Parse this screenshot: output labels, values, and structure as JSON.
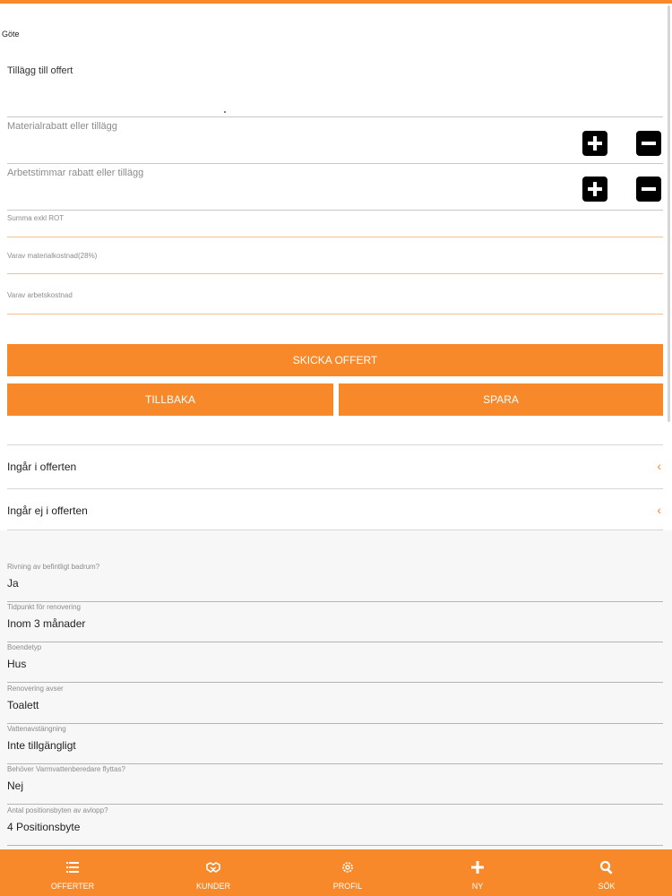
{
  "customer": {
    "name": "Göte"
  },
  "offer": {
    "title": "Tillägg till offert",
    "material_adjust_placeholder": "Materialrabatt eller tillägg",
    "labor_adjust_placeholder": "Arbetstimmar rabatt eller tillägg",
    "sum_label": "Summa exkl ROT",
    "material_cost_label": "Varav materialkostnad(28%)",
    "labor_cost_label": "Varav arbetskostnad"
  },
  "actions": {
    "send": "SKICKA OFFERT",
    "back": "TILLBAKA",
    "save": "SPARA"
  },
  "sections": [
    {
      "label": "Ingår i offerten"
    },
    {
      "label": "Ingår ej i offerten"
    }
  ],
  "details": [
    {
      "question": "Rivning av befintligt badrum?",
      "answer": "Ja"
    },
    {
      "question": "Tidpunkt för renovering",
      "answer": "Inom 3 månader"
    },
    {
      "question": "Boendetyp",
      "answer": "Hus"
    },
    {
      "question": "Renovering avser",
      "answer": "Toalett"
    },
    {
      "question": "Vattenavstängning",
      "answer": "Inte tillgängligt"
    },
    {
      "question": "Behöver Varmvattenberedare flyttas?",
      "answer": "Nej"
    },
    {
      "question": "Antal positionsbyten av avlopp?",
      "answer": "4 Positionsbyte"
    }
  ],
  "nav": [
    {
      "label": "OFFERTER",
      "icon": "list-icon"
    },
    {
      "label": "KUNDER",
      "icon": "handshake-icon"
    },
    {
      "label": "PROFIL",
      "icon": "gear-icon"
    },
    {
      "label": "NY",
      "icon": "plus-icon"
    },
    {
      "label": "SÖK",
      "icon": "search-icon"
    }
  ],
  "colors": {
    "accent": "#f7892a",
    "background": "#ffffff",
    "section_bg": "#f7f7f8"
  }
}
